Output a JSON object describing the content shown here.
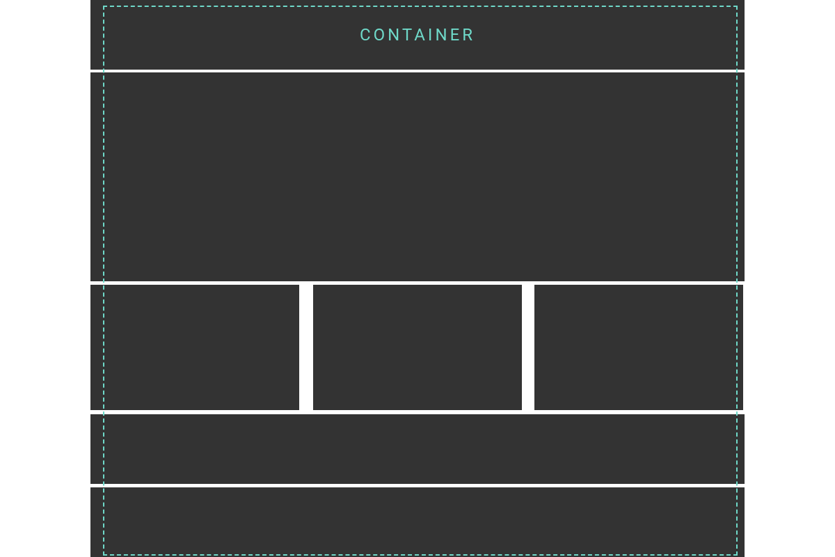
{
  "container": {
    "label": "CONTAINER"
  },
  "colors": {
    "block": "#333333",
    "accent": "#6fd9c9",
    "background": "#ffffff"
  }
}
